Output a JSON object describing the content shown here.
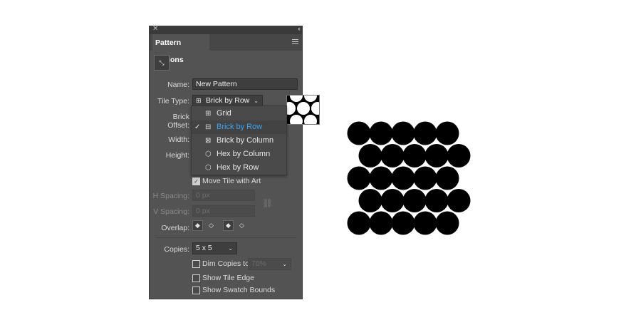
{
  "panel": {
    "title": "Pattern Options",
    "close_icon": "close-icon",
    "collapse_icon": "double-chevron-icon",
    "menu_icon": "hamburger-icon",
    "tile_tool_icon": "tile-edit-tool-icon"
  },
  "form": {
    "name_label": "Name:",
    "name_value": "New Pattern",
    "tile_type_label": "Tile Type:",
    "tile_type_value": "Brick by Row",
    "brick_offset_label": "Brick Offset:",
    "width_label": "Width:",
    "height_label": "Height:",
    "move_tile_label": "Move Tile with Art",
    "move_tile_checked": true,
    "h_spacing_label": "H Spacing:",
    "h_spacing_value": "0 px",
    "v_spacing_label": "V Spacing:",
    "v_spacing_value": "0 px",
    "overlap_label": "Overlap:",
    "copies_label": "Copies:",
    "copies_value": "5 x 5",
    "dim_copies_label": "Dim Copies to:",
    "dim_copies_value": "70%",
    "show_tile_edge_label": "Show Tile Edge",
    "show_swatch_bounds_label": "Show Swatch Bounds"
  },
  "dropdown": {
    "items": [
      {
        "label": "Grid",
        "icon": "grid-icon",
        "selected": false
      },
      {
        "label": "Brick by Row",
        "icon": "brick-row-icon",
        "selected": true
      },
      {
        "label": "Brick by Column",
        "icon": "brick-column-icon",
        "selected": false
      },
      {
        "label": "Hex by Column",
        "icon": "hex-column-icon",
        "selected": false
      },
      {
        "label": "Hex by Row",
        "icon": "hex-row-icon",
        "selected": false
      }
    ]
  },
  "colors": {
    "panel_bg": "#535353",
    "selected_text": "#3aa3f5",
    "pattern_fill": "#000000"
  }
}
